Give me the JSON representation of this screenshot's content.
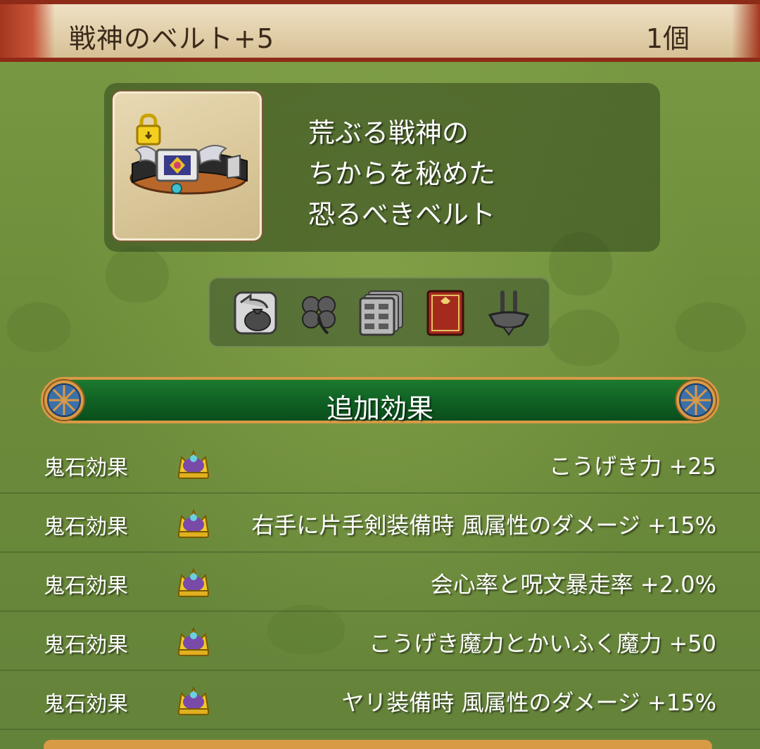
{
  "header": {
    "item_name": "戦神のベルト+5",
    "count": "1個"
  },
  "item": {
    "icon": "belt-icon",
    "lock_icon": "padlock-icon",
    "description": [
      "荒ぶる戦神の",
      "ちからを秘めた",
      "恐るべきベルト"
    ]
  },
  "properties": {
    "icons": [
      "bag-return-icon",
      "clover-icon",
      "storage-drawers-icon",
      "red-book-icon",
      "belt-anvil-icon"
    ]
  },
  "section": {
    "title": "追加効果"
  },
  "effects": [
    {
      "label": "鬼石効果",
      "value": "こうげき力 +25"
    },
    {
      "label": "鬼石効果",
      "value": "右手に片手剣装備時 風属性のダメージ +15%"
    },
    {
      "label": "鬼石効果",
      "value": "会心率と呪文暴走率 +2.0%"
    },
    {
      "label": "鬼石効果",
      "value": "こうげき魔力とかいふく魔力 +50"
    },
    {
      "label": "鬼石効果",
      "value": "ヤリ装備時 風属性のダメージ +15%"
    }
  ],
  "colors": {
    "title_frame": "#8e2a18",
    "title_bg": "#e2cfaa",
    "background": "#6e8a3a",
    "banner": "#0f6023",
    "banner_border": "#d99a46"
  }
}
